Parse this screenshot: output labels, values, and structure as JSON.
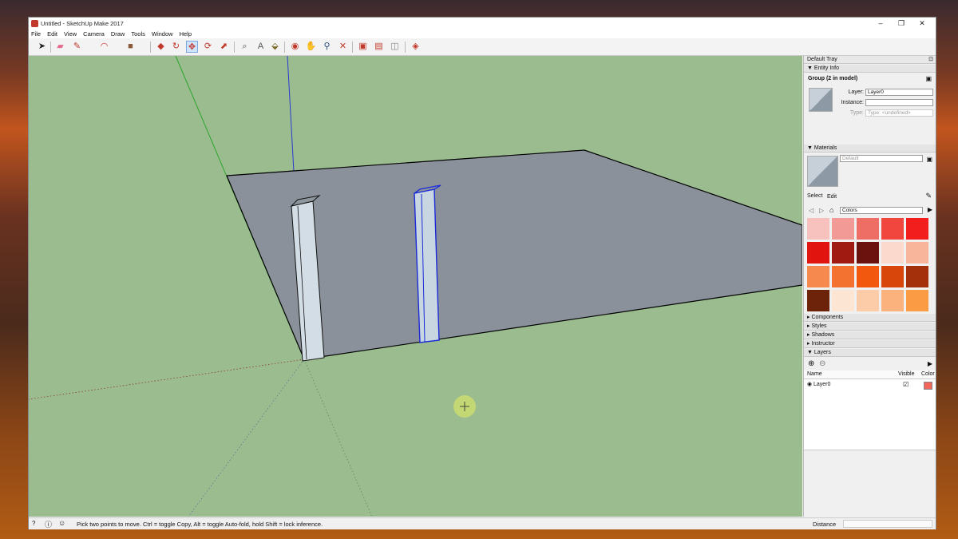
{
  "window": {
    "title": "Untitled - SketchUp Make 2017",
    "controls": [
      "–",
      "❐",
      "✕"
    ]
  },
  "menu": [
    "File",
    "Edit",
    "View",
    "Camera",
    "Draw",
    "Tools",
    "Window",
    "Help"
  ],
  "toolbar": [
    "select-icon",
    "eraser-icon",
    "pencil-icon",
    "arc-icon",
    "rectangle-icon",
    "push-pull-icon",
    "follow-me-icon",
    "move-icon",
    "rotate-icon",
    "scale-icon",
    "tape-measure-icon",
    "text-icon",
    "paint-bucket-icon",
    "orbit-icon",
    "pan-icon",
    "zoom-icon",
    "zoom-extents-icon",
    "warehouse-icon",
    "extension-warehouse-icon",
    "layout-icon",
    "ruby-icon"
  ],
  "tray": {
    "title": "Default Tray",
    "entity_info": {
      "header": "Entity Info",
      "group_label": "Group (2 in model)",
      "layer_label": "Layer:",
      "layer_value": "Layer0",
      "instance_label": "Instance:",
      "instance_value": "",
      "type_label": "Type:",
      "type_value": "Type: <undefined>"
    },
    "materials": {
      "header": "Materials",
      "current": "Default",
      "tab_select": "Select",
      "tab_edit": "Edit",
      "library": "Colors",
      "swatches": [
        "#f7c1bd",
        "#f29a95",
        "#ee6e65",
        "#f0463d",
        "#f21d1d",
        "#e2140f",
        "#a01a12",
        "#6c120e",
        "#fbd9cc",
        "#f8b59c",
        "#f5894e",
        "#f47230",
        "#f3590e",
        "#d8460b",
        "#a3300a",
        "#6d230a",
        "#fde5d4",
        "#fccba8",
        "#fbb27c",
        "#fb9b44"
      ]
    },
    "sections": [
      "Components",
      "Styles",
      "Shadows",
      "Instructor",
      "Layers"
    ],
    "layers": {
      "col_name": "Name",
      "col_visible": "Visible",
      "col_color": "Color",
      "rows": [
        {
          "name": "Layer0",
          "visible": "☑",
          "color": "#f2665c"
        }
      ]
    }
  },
  "status": {
    "message": "Pick two points to move.  Ctrl = toggle Copy, Alt = toggle Auto-fold, hold Shift = lock inference.",
    "measure_label": "Distance",
    "measure_value": ""
  }
}
